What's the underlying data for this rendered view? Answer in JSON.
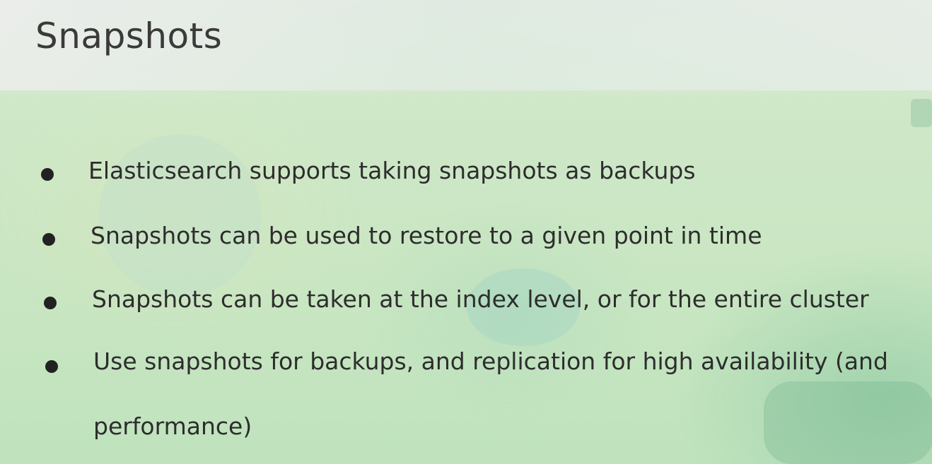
{
  "slide": {
    "title": "Snapshots",
    "bullets": [
      "Elasticsearch supports taking snapshots as backups",
      "Snapshots can be used to restore to a given point in time",
      "Snapshots can be taken at the index level, or for the entire cluster",
      "Use snapshots for backups, and replication for high availability (and performance)"
    ]
  },
  "colors": {
    "text": "#2d2d2d",
    "background": "#c9e6c2",
    "bullet_dot": "#222222"
  }
}
